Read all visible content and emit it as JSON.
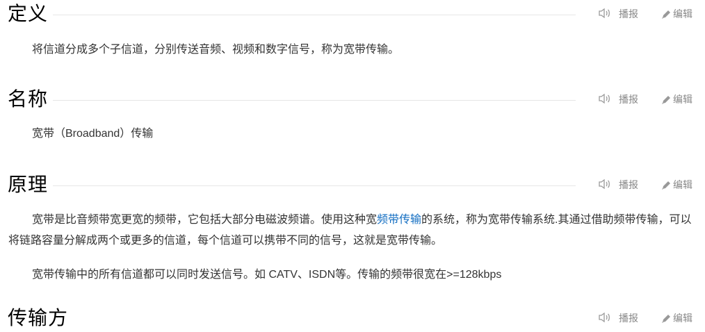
{
  "actions": {
    "listen_label": "播报",
    "edit_label": "编辑"
  },
  "sections": [
    {
      "title": "定义",
      "paragraphs": [
        "将信道分成多个子信道，分别传送音频、视频和数字信号，称为宽带传输。"
      ]
    },
    {
      "title": "名称",
      "paragraphs": [
        "宽带（Broadband）传输"
      ]
    },
    {
      "title": "原理",
      "paragraph1": {
        "before": "宽带是比音频带宽更宽的频带，它包括大部分电磁波频谱。使用这种宽",
        "link": "频带传输",
        "after": "的系统，称为宽带传输系统.其通过借助频带传输，可以将链路容量分解成两个或更多的信道，每个信道可以携带不同的信号，这就是宽带传输。"
      },
      "paragraph2": "宽带传输中的所有信道都可以同时发送信号。如 CATV、ISDN等。传输的频带很宽在>=128kbps"
    },
    {
      "title": "传输方"
    }
  ],
  "colors": {
    "link": "#136ec2",
    "text": "#333333",
    "title": "#000000",
    "action": "#888888"
  }
}
